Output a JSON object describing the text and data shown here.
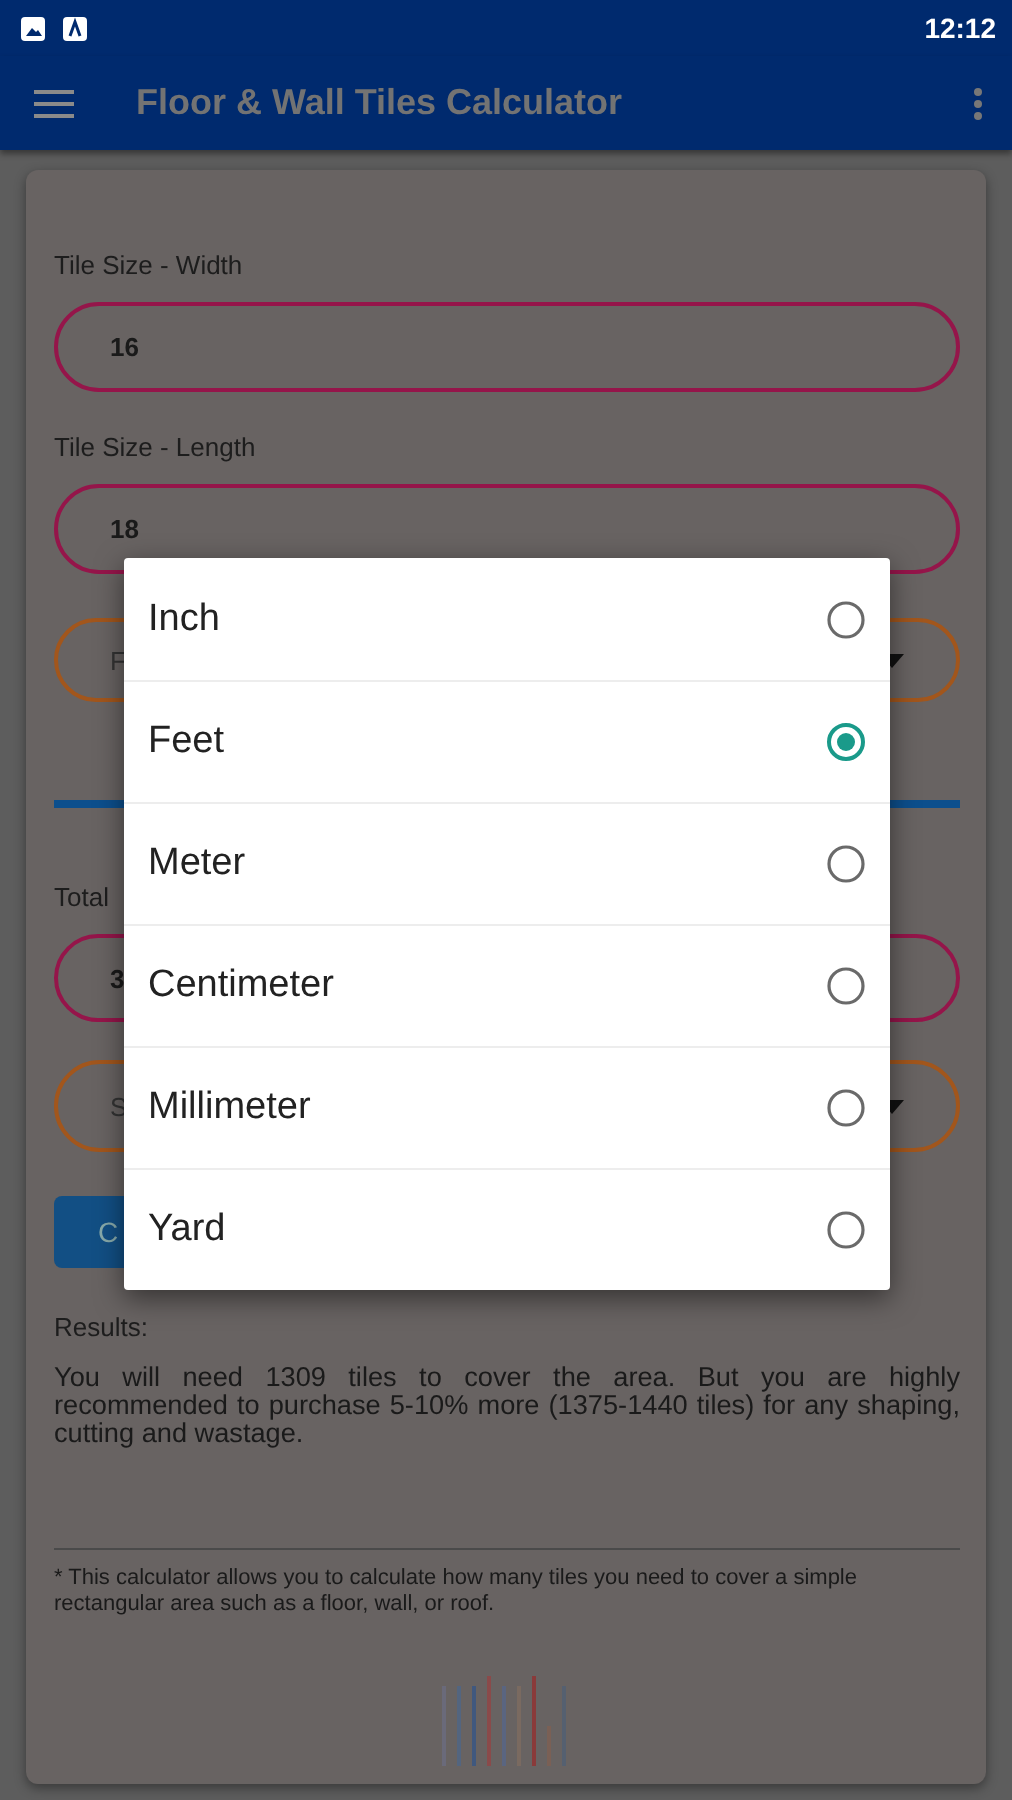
{
  "status_bar": {
    "time": "12:12"
  },
  "toolbar": {
    "title": "Floor & Wall Tiles Calculator"
  },
  "form": {
    "width_label": "Tile Size - Width",
    "width_value": "16",
    "length_label": "Tile Size - Length",
    "length_value": "18",
    "unit_select": "F",
    "total_label": "Total",
    "total_value": "3",
    "area_unit_select": "S",
    "calculate_button": "C"
  },
  "results": {
    "heading": "Results:",
    "text": "You will need 1309 tiles to cover the area. But you are highly recommended to purchase 5-10% more (1375-1440 tiles) for any shaping, cutting and wastage."
  },
  "footnote": "* This calculator allows you to calculate how many tiles you need to cover a simple rectangular area such as a floor, wall, or roof.",
  "dialog": {
    "options": [
      {
        "label": "Inch",
        "selected": false
      },
      {
        "label": "Feet",
        "selected": true
      },
      {
        "label": "Meter",
        "selected": false
      },
      {
        "label": "Centimeter",
        "selected": false
      },
      {
        "label": "Millimeter",
        "selected": false
      },
      {
        "label": "Yard",
        "selected": false
      }
    ]
  }
}
